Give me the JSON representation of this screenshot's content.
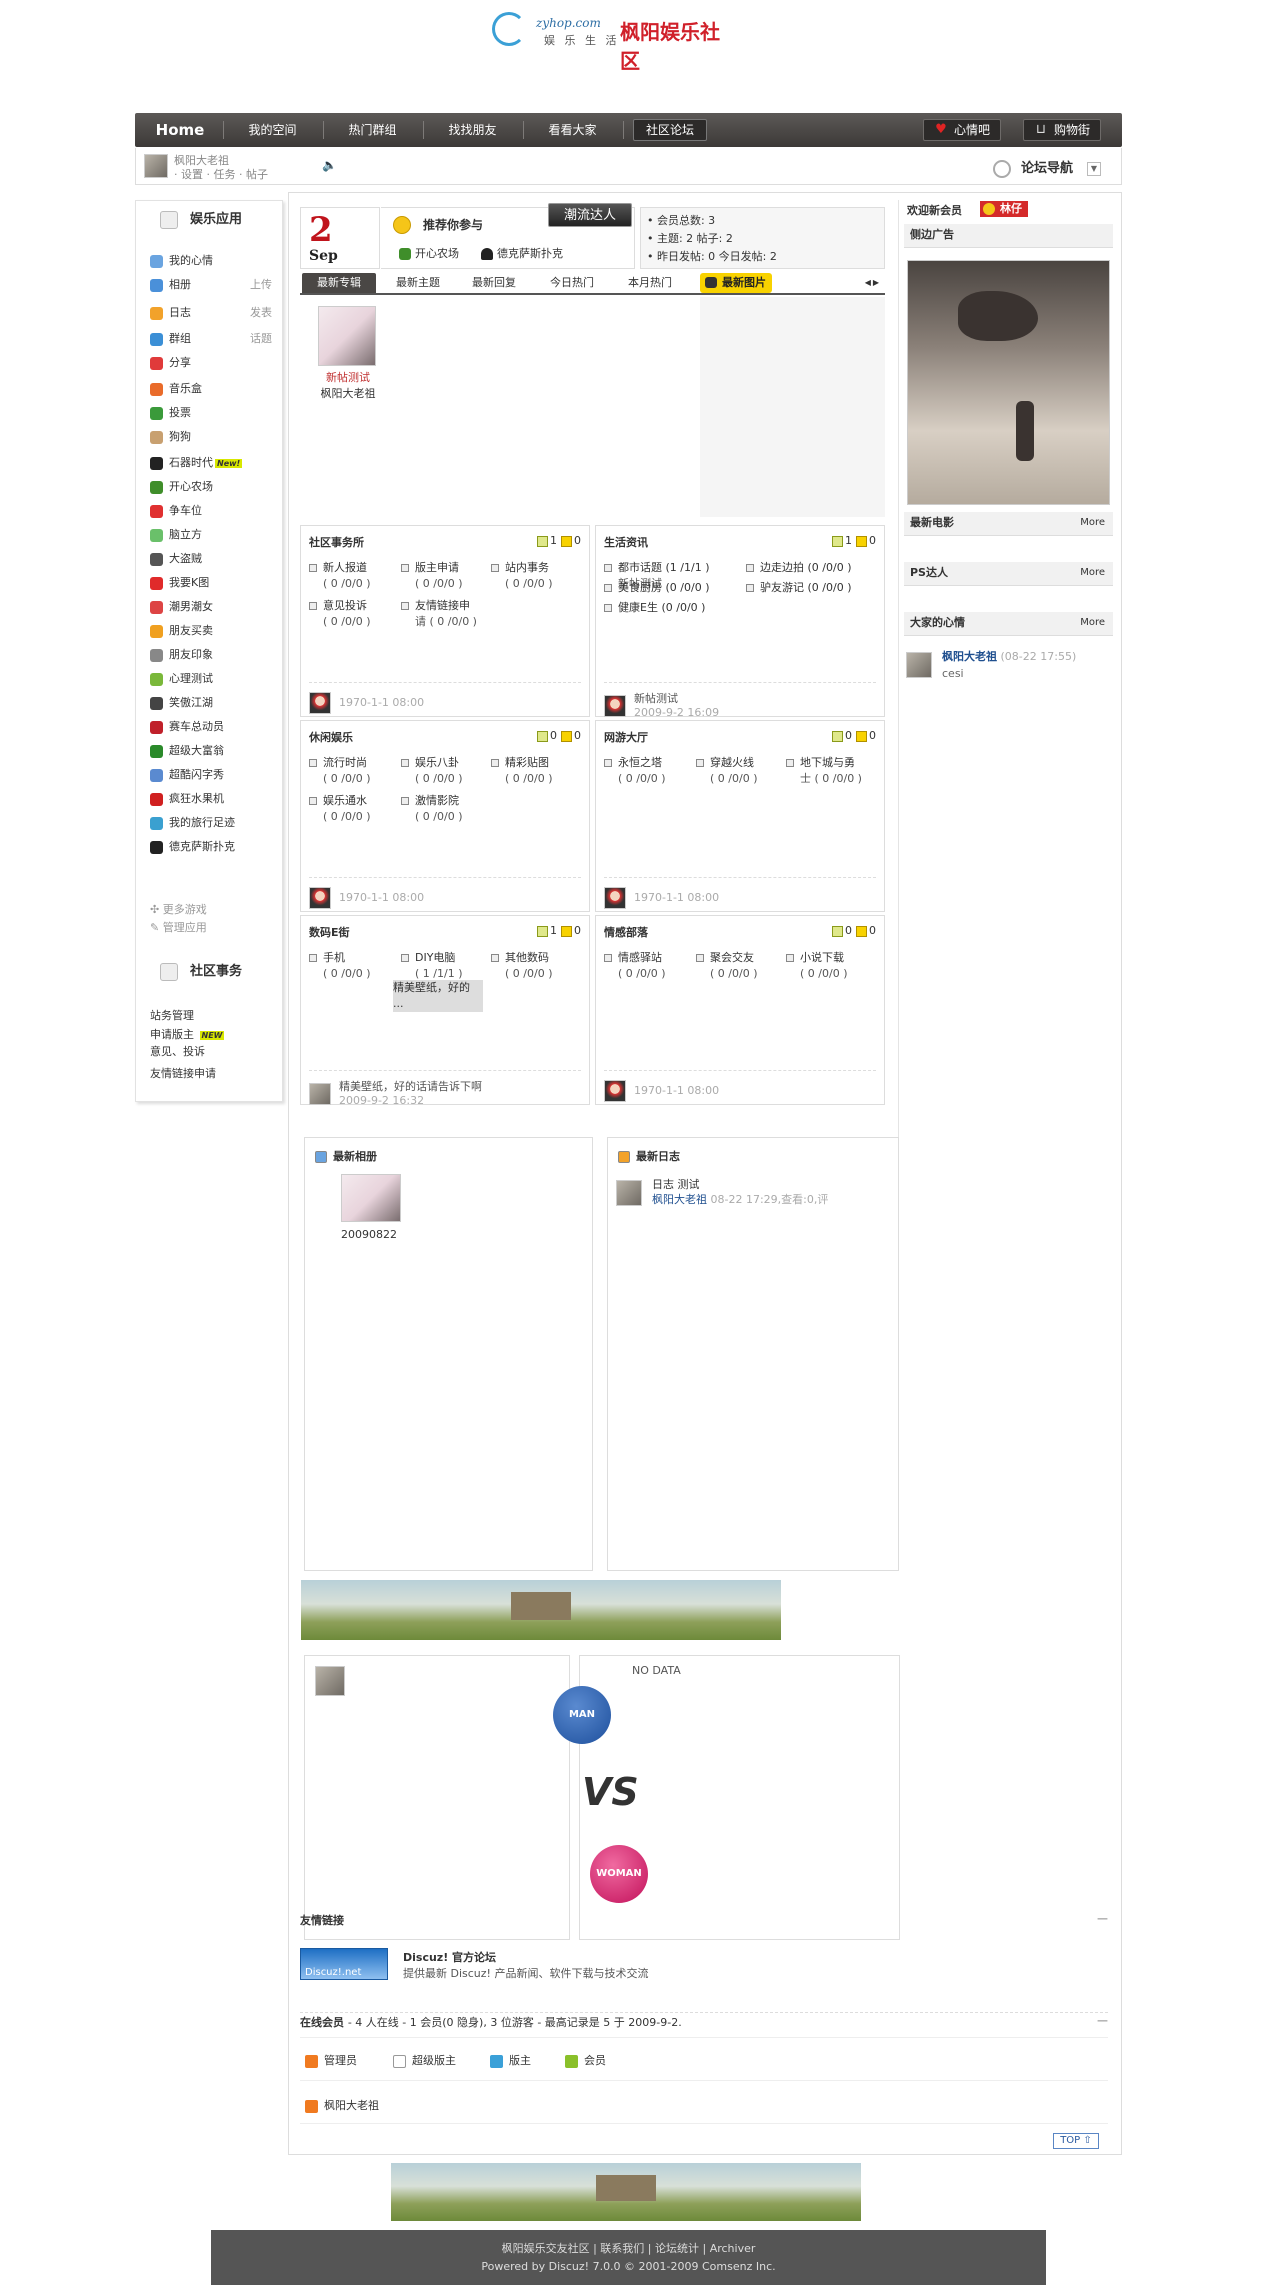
{
  "header": {
    "site_url": "zyhop.com",
    "slogan": "娱 乐 生 活",
    "brand": "枫阳娱乐社区"
  },
  "nav": {
    "home": "Home",
    "items": [
      "我的空间",
      "热门群组",
      "找找朋友",
      "看看大家",
      "社区论坛"
    ],
    "mood": "心情吧",
    "shop": "购物街"
  },
  "userbar": {
    "username": "枫阳大老祖",
    "links": "· 设置 · 任务 · 帖子",
    "forum_nav": "论坛导航"
  },
  "sidebar": {
    "apps_title": "娱乐应用",
    "apps": [
      {
        "label": "我的心情",
        "extra": "",
        "color": "#6aa4e0"
      },
      {
        "label": "相册",
        "extra": "上传",
        "color": "#4a90d9"
      },
      {
        "label": "日志",
        "extra": "发表",
        "color": "#f2a22a"
      },
      {
        "label": "群组",
        "extra": "话题",
        "color": "#3b8fd6"
      },
      {
        "label": "分享",
        "extra": "",
        "color": "#e03a3a"
      },
      {
        "label": "音乐盒",
        "extra": "",
        "color": "#e96b2a"
      },
      {
        "label": "投票",
        "extra": "",
        "color": "#3a9a3a"
      },
      {
        "label": "狗狗",
        "extra": "",
        "color": "#c8a070"
      },
      {
        "label": "石器时代",
        "extra": "",
        "color": "#222"
      },
      {
        "label": "开心农场",
        "extra": "",
        "color": "#3f8e2a"
      },
      {
        "label": "争车位",
        "extra": "",
        "color": "#e03030"
      },
      {
        "label": "脑立方",
        "extra": "",
        "color": "#6ac06a"
      },
      {
        "label": "大盗贼",
        "extra": "",
        "color": "#555"
      },
      {
        "label": "我要K图",
        "extra": "",
        "color": "#e02a2a"
      },
      {
        "label": "潮男潮女",
        "extra": "",
        "color": "#d44"
      },
      {
        "label": "朋友买卖",
        "extra": "",
        "color": "#f0a020"
      },
      {
        "label": "朋友印象",
        "extra": "",
        "color": "#888"
      },
      {
        "label": "心理测试",
        "extra": "",
        "color": "#7ab83a"
      },
      {
        "label": "笑傲江湖",
        "extra": "",
        "color": "#444"
      },
      {
        "label": "赛车总动员",
        "extra": "",
        "color": "#c0202a"
      },
      {
        "label": "超级大富翁",
        "extra": "",
        "color": "#2a8a2a"
      },
      {
        "label": "超酷闪字秀",
        "extra": "",
        "color": "#5a8ad0"
      },
      {
        "label": "疯狂水果机",
        "extra": "",
        "color": "#d02020"
      },
      {
        "label": "我的旅行足迹",
        "extra": "",
        "color": "#3aa0d0"
      },
      {
        "label": "德克萨斯扑克",
        "extra": "",
        "color": "#222"
      }
    ],
    "new_tag": "New!",
    "more_games": "更多游戏",
    "manage_apps": "管理应用",
    "affairs_title": "社区事务",
    "affairs": [
      "站务管理",
      "申请版主",
      "意见、投诉",
      "友情链接申请"
    ],
    "affairs_new": "NEW"
  },
  "top": {
    "day": "2",
    "month": "Sep",
    "recommend_title": "推荐你参与",
    "rec_1": "开心农场",
    "rec_2": "德克萨斯扑克",
    "trend": "潮流达人",
    "stats": [
      "• 会员总数: 3",
      "• 主题: 2   帖子: 2",
      "• 昨日发帖: 0   今日发帖: 2"
    ],
    "tabs": [
      "最新专辑",
      "最新主题",
      "最新回复",
      "今日热门",
      "本月热门",
      "最新图片"
    ],
    "thumb_title": "新帖测试",
    "thumb_author": "枫阳大老祖"
  },
  "forums": [
    {
      "name": "社区事务所",
      "c1": "1",
      "c2": "0",
      "subs": [
        [
          "新人报道",
          "( 0 /0/0 )"
        ],
        [
          "版主申请",
          "( 0 /0/0 )"
        ],
        [
          "站内事务",
          "( 0 /0/0 )"
        ],
        [
          "意见投诉",
          "( 0 /0/0 )"
        ],
        [
          "友情链接申",
          "请 ( 0 /0/0 )"
        ]
      ],
      "last": "",
      "date": "1970-1-1 08:00"
    },
    {
      "name": "生活资讯",
      "c1": "1",
      "c2": "0",
      "subs": [
        [
          "都市话题 (1 /1/1 )",
          "新帖测试"
        ],
        [
          "边走边拍 (0 /0/0 )",
          ""
        ],
        [
          "美食厨房 (0 /0/0 )",
          ""
        ],
        [
          "驴友游记 (0 /0/0 )",
          ""
        ],
        [
          "健康E生 (0 /0/0 )",
          ""
        ]
      ],
      "last": "新帖测试",
      "date": "2009-9-2 16:09"
    },
    {
      "name": "休闲娱乐",
      "c1": "0",
      "c2": "0",
      "subs": [
        [
          "流行时尚",
          "( 0 /0/0 )"
        ],
        [
          "娱乐八卦",
          "( 0 /0/0 )"
        ],
        [
          "精彩贴图",
          "( 0 /0/0 )"
        ],
        [
          "娱乐通水",
          "( 0 /0/0 )"
        ],
        [
          "激情影院",
          "( 0 /0/0 )"
        ]
      ],
      "last": "",
      "date": "1970-1-1 08:00"
    },
    {
      "name": "网游大厅",
      "c1": "0",
      "c2": "0",
      "subs": [
        [
          "永恒之塔",
          "( 0 /0/0 )"
        ],
        [
          "穿越火线",
          "( 0 /0/0 )"
        ],
        [
          "地下城与勇",
          "士 ( 0 /0/0 )"
        ]
      ],
      "last": "",
      "date": "1970-1-1 08:00"
    },
    {
      "name": "数码E街",
      "c1": "1",
      "c2": "0",
      "subs": [
        [
          "手机",
          "( 0 /0/0 )"
        ],
        [
          "DIY电脑",
          "( 1 /1/1 )"
        ],
        [
          "其他数码",
          "( 0 /0/0 )"
        ]
      ],
      "diy_last": "精美壁纸，好的 ...",
      "last": "精美壁纸，好的话请告诉下啊",
      "date": "2009-9-2 16:32"
    },
    {
      "name": "情感部落",
      "c1": "0",
      "c2": "0",
      "subs": [
        [
          "情感驿站",
          "( 0 /0/0 )"
        ],
        [
          "聚会交友",
          "( 0 /0/0 )"
        ],
        [
          "小说下载",
          "( 0 /0/0 )"
        ]
      ],
      "last": "",
      "date": "1970-1-1 08:00"
    }
  ],
  "right": {
    "welcome": "欢迎新会员",
    "new_member": "林仔",
    "ad": "侧边广告",
    "movie": "最新电影",
    "ps": "PS达人",
    "moods": "大家的心情",
    "more": "More",
    "mood_user": "枫阳大老祖",
    "mood_time": "(08-22 17:55)",
    "mood_text": "cesi"
  },
  "albums": {
    "title": "最新相册",
    "name": "20090822"
  },
  "blogs": {
    "title": "最新日志",
    "post": "日志 测试",
    "author": "枫阳大老祖",
    "meta": "08-22 17:29,查看:0,评"
  },
  "vs": {
    "man": "MAN",
    "woman": "WOMAN",
    "vs": "VS",
    "nodata": "NO DATA"
  },
  "links": {
    "title": "友情链接",
    "name": "Discuz! 官方论坛",
    "desc": "提供最新 Discuz! 产品新闻、软件下载与技术交流",
    "logo": "Discuz!.net"
  },
  "online": {
    "title": "在线会员",
    "summary": "- 4 人在线 - 1 会员(0 隐身), 3 位游客 - 最高记录是 5 于 2009-9-2.",
    "legend": [
      "管理员",
      "超级版主",
      "版主",
      "会员"
    ],
    "user": "枫阳大老祖"
  },
  "top_btn": "TOP",
  "footer": {
    "links": "枫阳娱乐交友社区 | 联系我们 | 论坛统计 | Archiver",
    "powered": "Powered by Discuz! 7.0.0 © 2001-2009 Comsenz Inc."
  }
}
